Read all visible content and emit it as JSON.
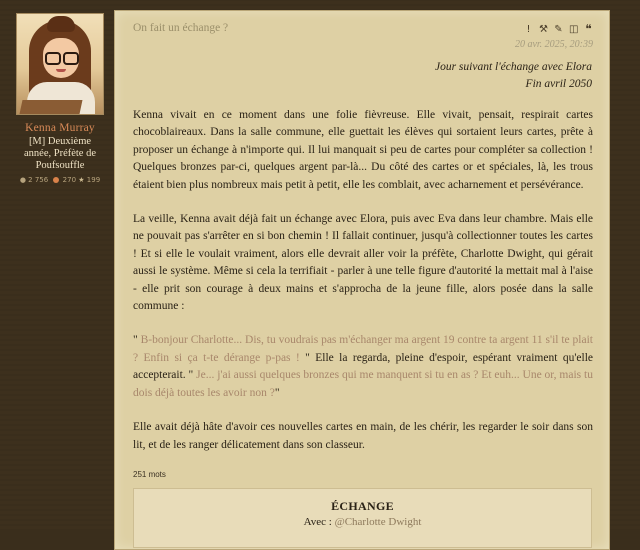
{
  "profile": {
    "avatar_alt": "avatar",
    "username": "Kenna Murray",
    "role": "[M] Deuxième année, Préfète de Poufsouffle",
    "messages_count": "2 756",
    "points_count": "270",
    "stars_count": "199",
    "colors": {
      "username": "#d98a58"
    }
  },
  "post": {
    "title": "On fait un échange ?",
    "date": "20 avr. 2025, 20:39",
    "tools": [
      "exclamation-icon",
      "edit-icon",
      "pencil-icon",
      "trash-icon",
      "quote-icon"
    ],
    "header_line1": "Jour suivant l'échange avec Elora",
    "header_line2": "Fin avril 2050",
    "paragraph1": "Kenna vivait en ce moment dans une folie fièvreuse. Elle vivait, pensait, respirait cartes chocoblaireaux. Dans la salle commune, elle guettait les élèves qui sortaient leurs cartes, prête à proposer un échange à n'importe qui. Il lui manquait si peu de cartes pour compléter sa collection ! Quelques bronzes par-ci, quelques argent par-là... Du côté des cartes or et spéciales, là, les trous étaient bien plus nombreux mais petit à petit, elle les comblait, avec acharnement et persévérance.",
    "paragraph2": "La veille, Kenna avait déjà fait un échange avec Elora, puis avec Eva dans leur chambre. Mais elle ne pouvait pas s'arrêter en si bon chemin ! Il fallait continuer, jusqu'à collectionner toutes les cartes ! Et si elle le voulait vraiment, alors elle devrait aller voir la préfète, Charlotte Dwight, qui gérait aussi le système. Même si cela la terrifiait - parler à une telle figure d'autorité la mettait mal à l'aise - elle prit son courage à deux mains et s'approcha de la jeune fille, alors posée dans la salle commune :",
    "p3_quote_open": "\" ",
    "p3_dialog1": "B-bonjour Charlotte... Dis, tu voudrais pas m'échanger ma argent 19 contre ta argent 11 s'il te plait ? Enfin si ça t-te dérange p-pas !",
    "p3_mid": " \" Elle la regarda, pleine d'espoir, espérant vraiment qu'elle accepterait. \" ",
    "p3_dialog2": "Je... j'ai aussi quelques bronzes qui me manquent si tu en as ? Et euh... Une or, mais tu dois déjà toutes les avoir non ?",
    "p3_quote_close": "\"",
    "paragraph4": "Elle avait déjà hâte d'avoir ces nouvelles cartes en main, de les chérir, les regarder le soir dans son lit, et de les ranger délicatement dans son classeur.",
    "word_count": "251 mots",
    "colors": {
      "dialog": "#a8876b",
      "panel": "#ded0a4"
    }
  },
  "exchange": {
    "title": "ÉCHANGE",
    "with_label": "Avec : ",
    "with_value": "@Charlotte Dwight"
  }
}
